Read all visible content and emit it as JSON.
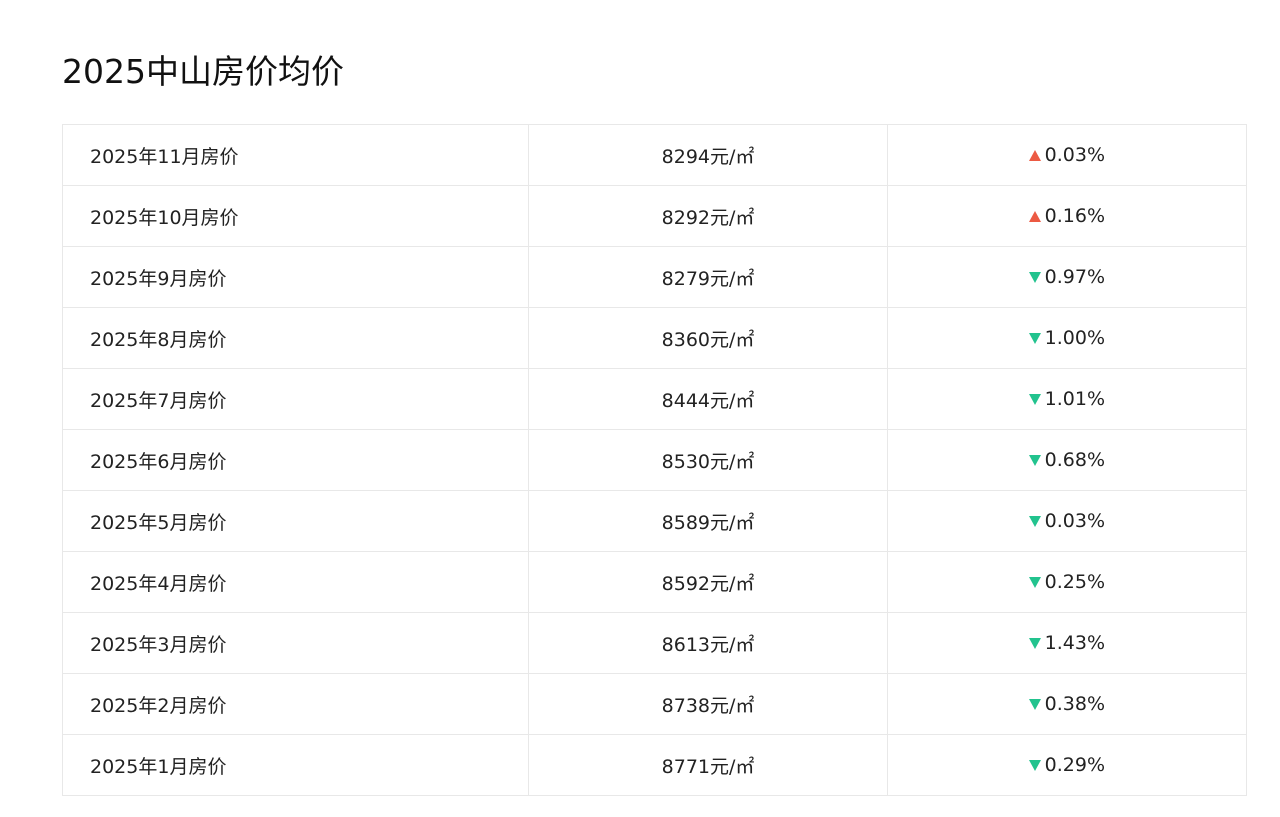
{
  "page": {
    "title": "2025中山房价均价"
  },
  "colors": {
    "up": "#ec5a43",
    "down": "#22c38e",
    "border": "#e8e8e8"
  },
  "table": {
    "rows": [
      {
        "month": "2025年11月房价",
        "price": "8294元/㎡",
        "change": "0.03%",
        "direction": "up",
        "icon": "triangle-up-icon"
      },
      {
        "month": "2025年10月房价",
        "price": "8292元/㎡",
        "change": "0.16%",
        "direction": "up",
        "icon": "triangle-up-icon"
      },
      {
        "month": "2025年9月房价",
        "price": "8279元/㎡",
        "change": "0.97%",
        "direction": "down",
        "icon": "triangle-down-icon"
      },
      {
        "month": "2025年8月房价",
        "price": "8360元/㎡",
        "change": "1.00%",
        "direction": "down",
        "icon": "triangle-down-icon"
      },
      {
        "month": "2025年7月房价",
        "price": "8444元/㎡",
        "change": "1.01%",
        "direction": "down",
        "icon": "triangle-down-icon"
      },
      {
        "month": "2025年6月房价",
        "price": "8530元/㎡",
        "change": "0.68%",
        "direction": "down",
        "icon": "triangle-down-icon"
      },
      {
        "month": "2025年5月房价",
        "price": "8589元/㎡",
        "change": "0.03%",
        "direction": "down",
        "icon": "triangle-down-icon"
      },
      {
        "month": "2025年4月房价",
        "price": "8592元/㎡",
        "change": "0.25%",
        "direction": "down",
        "icon": "triangle-down-icon"
      },
      {
        "month": "2025年3月房价",
        "price": "8613元/㎡",
        "change": "1.43%",
        "direction": "down",
        "icon": "triangle-down-icon"
      },
      {
        "month": "2025年2月房价",
        "price": "8738元/㎡",
        "change": "0.38%",
        "direction": "down",
        "icon": "triangle-down-icon"
      },
      {
        "month": "2025年1月房价",
        "price": "8771元/㎡",
        "change": "0.29%",
        "direction": "down",
        "icon": "triangle-down-icon"
      }
    ]
  }
}
